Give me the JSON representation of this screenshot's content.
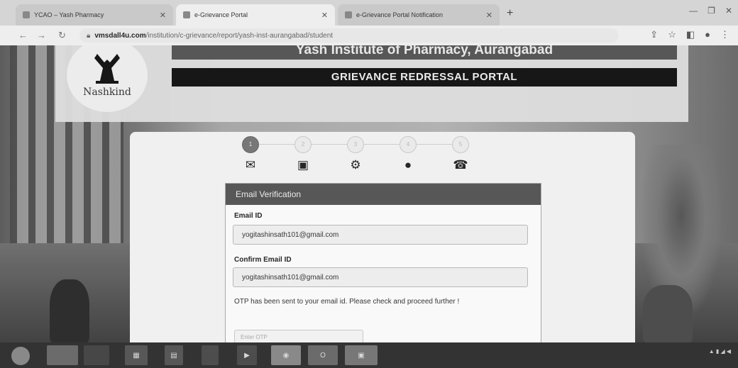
{
  "browser": {
    "tabs": [
      {
        "title": "YCAO – Yash Pharmacy",
        "active": false
      },
      {
        "title": "e-Grievance Portal",
        "active": true
      },
      {
        "title": "e-Grievance Portal Notification",
        "active": false
      }
    ],
    "new_tab": "+",
    "url_host": "vmsdall4u.com",
    "url_path": "/institution/c-grievance/report/yash-inst-aurangabad/student"
  },
  "header": {
    "logo_text": "Nashkind",
    "institute_name": "Yash Institute of Pharmacy, Aurangabad",
    "portal_title": "GRIEVANCE REDRESSAL PORTAL"
  },
  "steps": [
    {
      "number": "1",
      "icon": "envelope-icon",
      "glyph": "✉",
      "active": true
    },
    {
      "number": "2",
      "icon": "address-book-icon",
      "glyph": "▣",
      "active": false
    },
    {
      "number": "3",
      "icon": "cogs-icon",
      "glyph": "⚙",
      "active": false
    },
    {
      "number": "4",
      "icon": "comment-icon",
      "glyph": "●",
      "active": false
    },
    {
      "number": "5",
      "icon": "phone-icon",
      "glyph": "☎",
      "active": false
    }
  ],
  "form": {
    "panel_title": "Email Verification",
    "email_label": "Email ID",
    "email_value": "yogitashinsath101@gmail.com",
    "confirm_label": "Confirm Email ID",
    "confirm_value": "yogitashinsath101@gmail.com",
    "otp_message": "OTP has been sent to your email id. Please check and proceed further !",
    "otp_placeholder": "Enter OTP"
  }
}
